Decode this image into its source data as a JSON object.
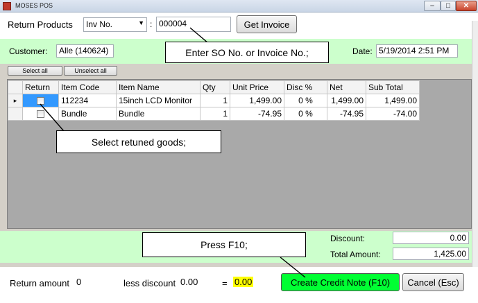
{
  "window": {
    "title": "MOSES POS"
  },
  "header": {
    "section_label": "Return Products",
    "lookup_type": "Inv No.",
    "separator": ":",
    "invoice_no": "000004",
    "get_invoice": "Get Invoice"
  },
  "customer": {
    "label": "Customer:",
    "value": "Alle (140624)"
  },
  "date": {
    "label": "Date:",
    "value": "5/19/2014 2:51 PM"
  },
  "callouts": {
    "enter_so": "Enter SO No. or Invoice No.;",
    "select_goods": "Select retuned goods;",
    "press_f10": "Press F10;"
  },
  "selection": {
    "select_all": "Select all",
    "unselect_all": "Unselect all"
  },
  "grid": {
    "columns": [
      "Return",
      "Item Code",
      "Item Name",
      "Qty",
      "Unit Price",
      "Disc %",
      "Net",
      "Sub Total"
    ],
    "rows": [
      {
        "current": "▸",
        "code": "112234",
        "name": "15inch LCD Monitor",
        "qty": "1",
        "unit_price": "1,499.00",
        "disc": "0 %",
        "net": "1,499.00",
        "sub_total": "1,499.00"
      },
      {
        "current": "",
        "code": "Bundle",
        "name": "Bundle",
        "qty": "1",
        "unit_price": "-74.95",
        "disc": "0 %",
        "net": "-74.95",
        "sub_total": "-74.00"
      }
    ]
  },
  "totals": {
    "discount_label": "Discount:",
    "discount_value": "0.00",
    "total_label": "Total Amount:",
    "total_value": "1,425.00"
  },
  "footer": {
    "return_amount_label": "Return amount",
    "return_amount_value": "0",
    "less_discount_label": "less discount",
    "less_discount_value": "0.00",
    "equals": "=",
    "result": "0.00",
    "create_credit_note": "Create Credit Note (F10)",
    "cancel": "Cancel (Esc)"
  },
  "colors": {
    "panel_green": "#ccffcc",
    "create_button": "#00ff33",
    "result_highlight": "#ffff00",
    "selected_cell": "#3399ff"
  }
}
